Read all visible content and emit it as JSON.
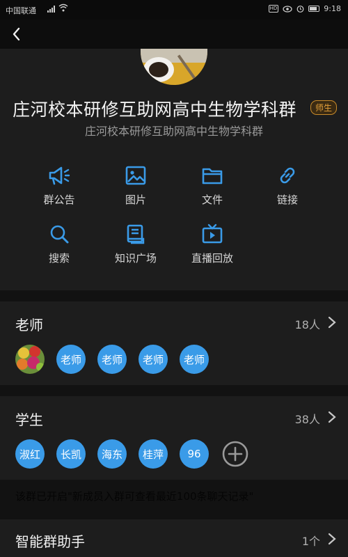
{
  "status_bar": {
    "carrier": "中国联通",
    "hd_badge": "HD",
    "time": "9:18"
  },
  "group": {
    "name": "庄河校本研修互助网高中生物学科群",
    "tag": "师生",
    "subtitle": "庄河校本研修互助网高中生物学科群"
  },
  "features": [
    {
      "label": "群公告",
      "icon": "megaphone-icon"
    },
    {
      "label": "图片",
      "icon": "image-icon"
    },
    {
      "label": "文件",
      "icon": "folder-icon"
    },
    {
      "label": "链接",
      "icon": "link-icon"
    },
    {
      "label": "搜索",
      "icon": "search-icon"
    },
    {
      "label": "知识广场",
      "icon": "book-icon"
    },
    {
      "label": "直播回放",
      "icon": "tv-icon"
    }
  ],
  "teachers": {
    "title": "老师",
    "count": "18人",
    "members": [
      "老师",
      "老师",
      "老师",
      "老师"
    ]
  },
  "students": {
    "title": "学生",
    "count": "38人",
    "members": [
      "淑红",
      "长凯",
      "海东",
      "桂萍",
      "96"
    ]
  },
  "notice": "该群已开启\"新成员入群可查看最近100条聊天记录\"",
  "assistant": {
    "title": "智能群助手",
    "count": "1个"
  },
  "colors": {
    "accent": "#3a9be8",
    "tag": "#e5a13a",
    "background": "#121212",
    "panel": "#1d1d1d"
  }
}
